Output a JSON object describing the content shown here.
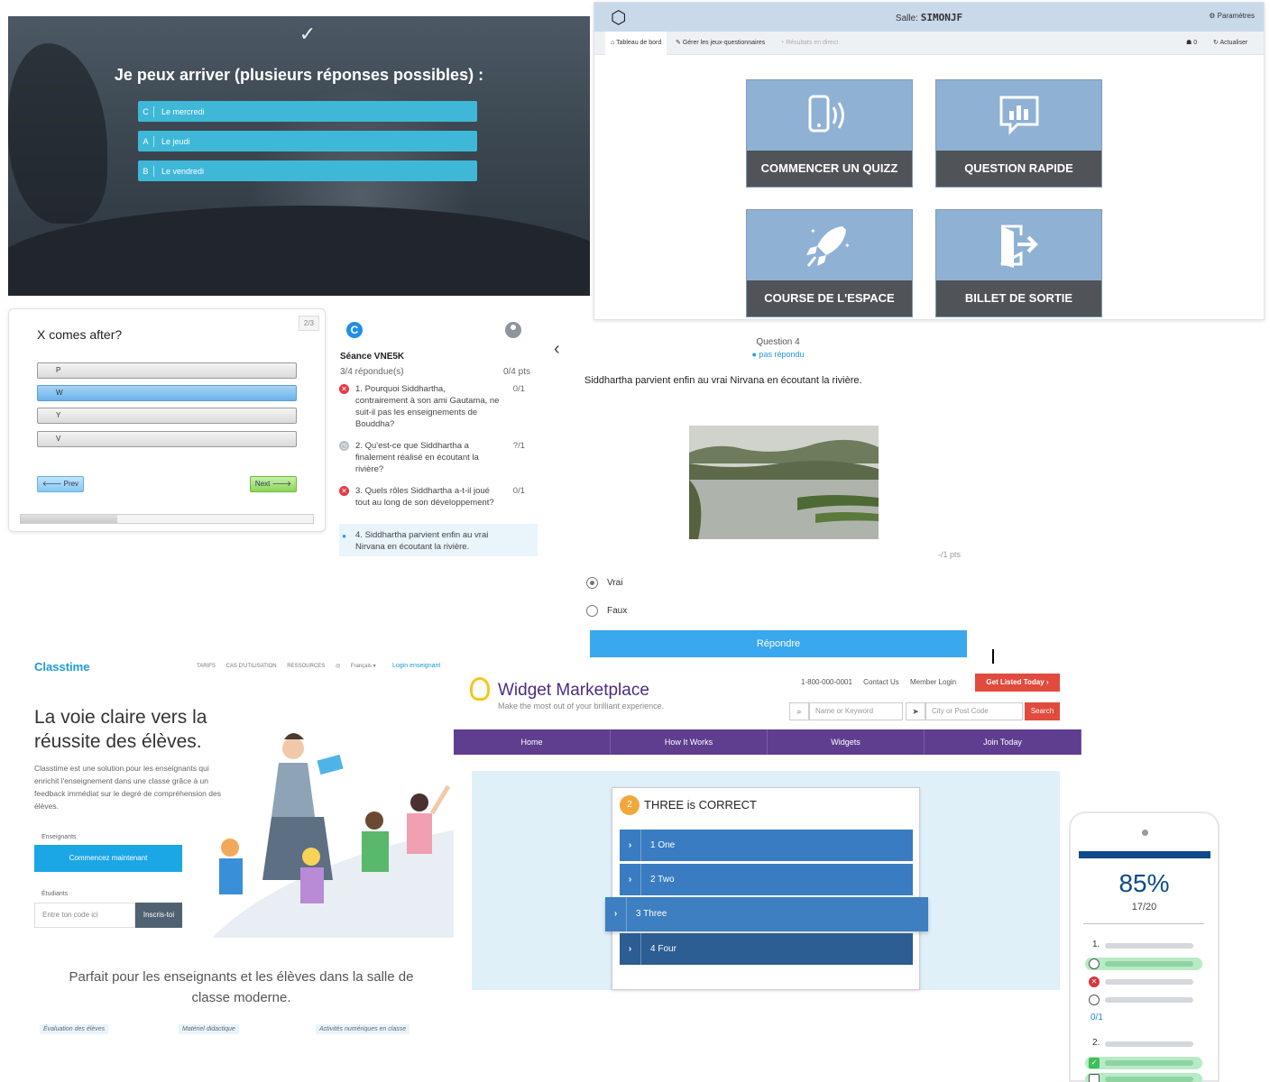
{
  "p1": {
    "question": "Je peux arriver (plusieurs réponses possibles) :",
    "options": [
      {
        "key": "C",
        "label": "Le mercredi"
      },
      {
        "key": "A",
        "label": "Le jeudi"
      },
      {
        "key": "B",
        "label": "Le vendredi"
      }
    ],
    "colors": {
      "option": "#3fb8d8"
    }
  },
  "p2": {
    "salle_label": "Salle:",
    "salle_name": "SIMONJF",
    "params": "Paramètres",
    "tabs": [
      "Tableau de bord",
      "Gérer les jeux-questionnaires",
      "Résultats en direct"
    ],
    "count": "0",
    "refresh": "Actualiser",
    "buttons": [
      "COMMENCER UN QUIZZ",
      "QUESTION RAPIDE",
      "COURSE DE L'ESPACE",
      "BILLET DE SORTIE"
    ]
  },
  "p3": {
    "title": "X comes after?",
    "page": "2/3",
    "options": [
      "P",
      "W",
      "Y",
      "V"
    ],
    "selected": 1,
    "prev": "Prev",
    "next": "Next",
    "progress": 0.33
  },
  "p4": {
    "logo": "C",
    "session": "Séance VNE5K",
    "answered": "3/4 répondue(s)",
    "points": "0/4 pts",
    "questions": [
      {
        "num": "1.",
        "text": "Pourquoi Siddhartha, contrairement à son ami Gautama, ne suit-il pas les enseignements de Bouddha?",
        "score": "0/1",
        "state": "wrong"
      },
      {
        "num": "2.",
        "text": "Qu'est-ce que Siddhartha a finalement réalisé en écoutant la rivière?",
        "score": "?/1",
        "state": "pending"
      },
      {
        "num": "3.",
        "text": "Quels rôles Siddhartha a-t-il joué tout au long de son développement?",
        "score": "0/1",
        "state": "wrong"
      },
      {
        "num": "4.",
        "text": "Siddhartha parvient enfin au vrai Nirvana en écoutant la rivière.",
        "score": "",
        "state": "current"
      }
    ]
  },
  "p5": {
    "qnum": "Question 4",
    "status": "● pas répondu",
    "statement": "Siddhartha parvient enfin au vrai Nirvana en écoutant la rivière.",
    "points": "-/1 pts",
    "options": [
      "Vrai",
      "Faux"
    ],
    "selected": 0,
    "submit": "Répondre"
  },
  "p6": {
    "brand": "Classtime",
    "nav": [
      "TARIFS",
      "CAS D'UTILISATION",
      "RESSOURCES",
      "Français ▾"
    ],
    "login": "Login enseignant",
    "headline": "La voie claire vers la réussite des élèves.",
    "desc": "Classtime est une solution pour les enseignants qui enrichit l'enseignement dans une classe grâce à un feedback immédiat sur le degré de compréhension des élèves.",
    "teachers_label": "Enseignants",
    "cta": "Commencez maintenant",
    "students_label": "Étudiants",
    "code_placeholder": "Entre ton code ici",
    "signup": "Inscris-toi",
    "tagline": "Parfait pour les enseignants et les élèves dans la salle de classe moderne.",
    "features": [
      "Évaluation des élèves",
      "Matériel didactique",
      "Activités numériques en classe"
    ]
  },
  "p7": {
    "title": "Widget Marketplace",
    "subtitle": "Make the most out of your brilliant experience.",
    "phone": "1-800-000-0001",
    "contact": "Contact Us",
    "member": "Member Login",
    "get_listed": "Get Listed Today",
    "keyword_placeholder": "Name or Keyword",
    "city_placeholder": "City or Post Code",
    "search": "Search",
    "menu": [
      "Home",
      "How It Works",
      "Widgets",
      "Join Today"
    ],
    "card_num": "2",
    "card_title": "THREE is CORRECT",
    "options": [
      "1 One",
      "2 Two",
      "3 Three",
      "4 Four"
    ],
    "colors": {
      "accent": "#5f3d8f",
      "button": "#e14b3d"
    }
  },
  "p8": {
    "percent": "85%",
    "fraction": "17/20",
    "q1": "1.",
    "score": "0/1",
    "q2": "2."
  }
}
